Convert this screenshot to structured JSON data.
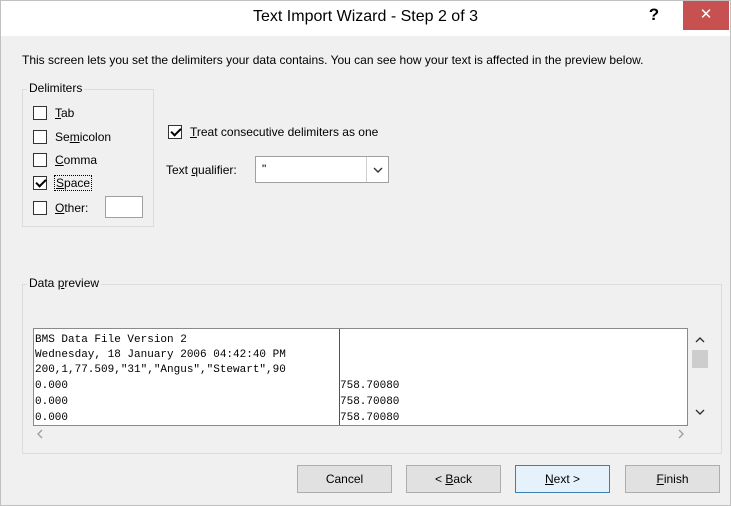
{
  "window": {
    "title": "Text Import Wizard - Step 2 of 3",
    "help_glyph": "?",
    "close_glyph": "✕"
  },
  "intro": "This screen lets you set the delimiters your data contains.  You can see how your text is affected in the preview below.",
  "delimiters": {
    "group_label": "Delimiters",
    "items": [
      {
        "label_before": "",
        "mnemonic": "T",
        "label_after": "ab",
        "checked": false
      },
      {
        "label_before": "Se",
        "mnemonic": "m",
        "label_after": "icolon",
        "checked": false
      },
      {
        "label_before": "",
        "mnemonic": "C",
        "label_after": "omma",
        "checked": false
      },
      {
        "label_before": "",
        "mnemonic": "S",
        "label_after": "pace",
        "checked": true
      },
      {
        "label_before": "",
        "mnemonic": "O",
        "label_after": "ther:",
        "checked": false
      }
    ],
    "other_value": ""
  },
  "consecutive": {
    "label_before": "",
    "mnemonic": "T",
    "label_after": "reat consecutive delimiters as one",
    "checked": true
  },
  "qualifier": {
    "label_before": "Text ",
    "mnemonic": "q",
    "label_after": "ualifier:",
    "value": "\""
  },
  "preview": {
    "label_before": "Data ",
    "mnemonic": "p",
    "label_after": "review",
    "lines": [
      {
        "col1": "BMS Data File Version 2",
        "col2": ""
      },
      {
        "col1": "Wednesday, 18 January 2006 04:42:40 PM",
        "col2": ""
      },
      {
        "col1": "200,1,77.509,\"31\",\"Angus\",\"Stewart\",90",
        "col2": ""
      },
      {
        "col1": "0.000",
        "col2": "758.70080"
      },
      {
        "col1": "0.000",
        "col2": "758.70080"
      },
      {
        "col1": "0.000",
        "col2": "758.70080"
      }
    ]
  },
  "buttons": {
    "cancel": {
      "before": "Cancel",
      "mnemonic": "",
      "after": ""
    },
    "back": {
      "before": "< ",
      "mnemonic": "B",
      "after": "ack"
    },
    "next": {
      "before": "",
      "mnemonic": "N",
      "after": "ext >"
    },
    "finish": {
      "before": "",
      "mnemonic": "F",
      "after": "inish"
    }
  }
}
